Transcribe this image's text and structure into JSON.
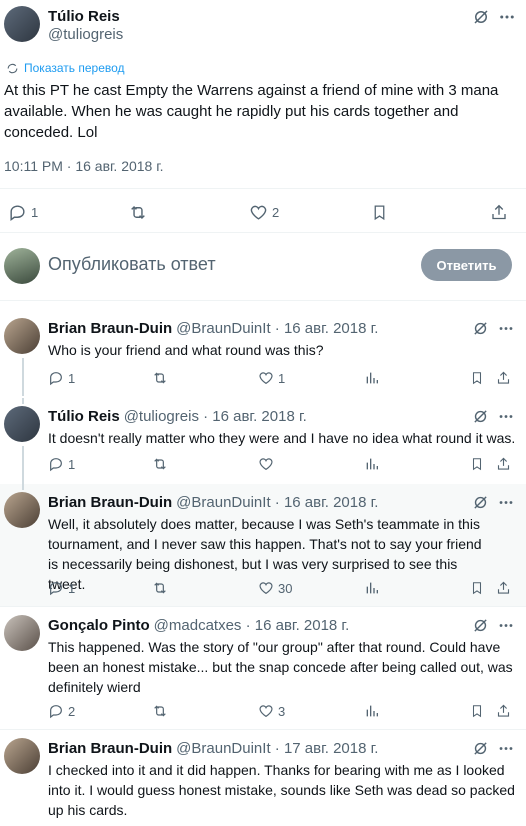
{
  "main_tweet": {
    "author_name": "Túlio Reis",
    "author_handle": "@tuliogreis",
    "translate_label": "Показать перевод",
    "text": "At this PT he cast Empty the Warrens against a friend of mine with 3 mana available. When he was caught he rapidly put his cards together and conceded. Lol",
    "timestamp": "10:11 PM · 16 авг. 2018 г.",
    "reply_count": "1",
    "like_count": "2"
  },
  "composer": {
    "placeholder": "Опубликовать ответ",
    "button_label": "Ответить"
  },
  "replies": [
    {
      "name": "Brian Braun-Duin",
      "meta": "@BraunDuinIt · 16 авг. 2018 г.",
      "text": "Who is your friend and what round was this?",
      "reply_count": "1",
      "like_count": "1"
    },
    {
      "name": "Túlio Reis",
      "meta": "@tuliogreis · 16 авг. 2018 г.",
      "text": "It doesn't really matter who they were and I have no idea what round it was.",
      "reply_count": "1",
      "like_count": ""
    },
    {
      "name": "Brian Braun-Duin",
      "meta": "@BraunDuinIt · 16 авг. 2018 г.",
      "text": "Well, it absolutely does matter, because I was Seth's teammate in this tournament, and I never saw this happen. That's not to say your friend is necessarily being dishonest, but I was very surprised to see this tweet.",
      "reply_count": "1",
      "like_count": "30"
    },
    {
      "name": "Gonçalo Pinto",
      "meta": "@madcatxes · 16 авг. 2018 г.",
      "text": "This happened. Was the story of \"our group\" after that round. Could have been an honest mistake... but the snap concede after being called out, was definitely wierd",
      "reply_count": "2",
      "like_count": "3"
    },
    {
      "name": "Brian Braun-Duin",
      "meta": "@BraunDuinIt · 17 авг. 2018 г.",
      "text": "I checked into it and it did happen.  Thanks for bearing with me as I looked into it.  I would guess honest mistake, sounds like Seth was dead so packed up his cards.",
      "reply_count": "",
      "like_count": ""
    }
  ]
}
